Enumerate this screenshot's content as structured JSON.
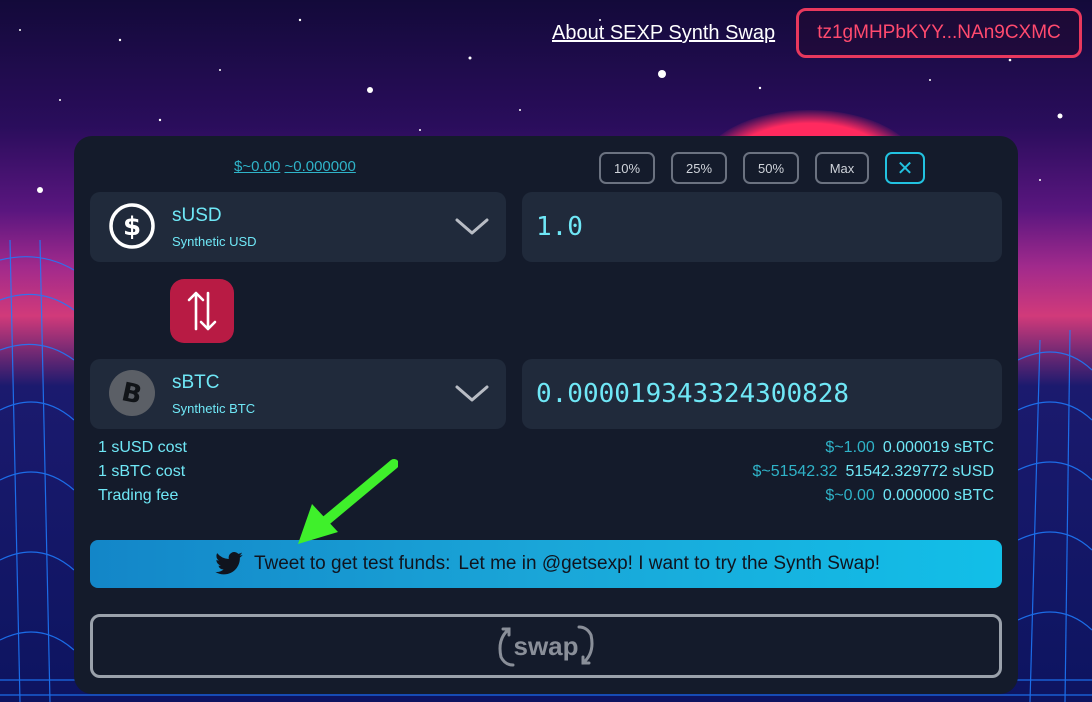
{
  "header": {
    "about_link": "About SEXP Synth Swap",
    "wallet_address": "tz1gMHPbKYY...NAn9CXMC"
  },
  "card": {
    "balance_usd": "$~0.00",
    "balance_amount": "~0.000000",
    "percent_buttons": [
      "10%",
      "25%",
      "50%",
      "Max"
    ],
    "close_symbol": "✕"
  },
  "from_token": {
    "symbol": "sUSD",
    "name": "Synthetic USD",
    "amount": "1.0",
    "icon": "dollar-coin-icon"
  },
  "to_token": {
    "symbol": "sBTC",
    "name": "Synthetic BTC",
    "amount": "0.000019343324300828",
    "icon": "bitcoin-coin-icon"
  },
  "info": [
    {
      "label": "1 sUSD cost",
      "usd": "$~1.00",
      "amount": "0.000019 sBTC"
    },
    {
      "label": "1 sBTC cost",
      "usd": "$~51542.32",
      "amount": "51542.329772 sUSD"
    },
    {
      "label": "Trading fee",
      "usd": "$~0.00",
      "amount": "0.000000 sBTC"
    }
  ],
  "tweet": {
    "prefix": "Tweet to get test funds:",
    "message": "Let me in @getsexp! I want to try the Synth Swap!"
  },
  "swap_button": {
    "label": "swap"
  },
  "colors": {
    "accent_cyan": "#6fe7f6",
    "wallet_red": "#e8385d",
    "swap_direction": "#b81b44",
    "card_bg": "#141b2b"
  }
}
